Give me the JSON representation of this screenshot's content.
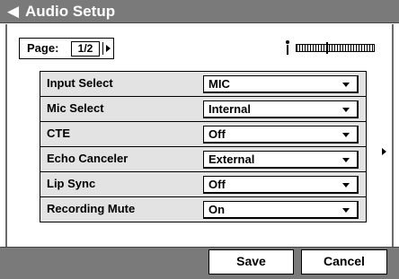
{
  "title_bar": {
    "icon": "speaker-icon",
    "title": "Audio Setup"
  },
  "pagination": {
    "label": "Page:",
    "value": "1/2",
    "next_icon": "right-arrow-icon"
  },
  "input_level": {
    "icon": "microphone-icon",
    "level_fraction": 0.38
  },
  "settings": [
    {
      "label": "Input Select",
      "value": "MIC"
    },
    {
      "label": "Mic Select",
      "value": "Internal"
    },
    {
      "label": "CTE",
      "value": "Off"
    },
    {
      "label": "Echo Canceler",
      "value": "External"
    },
    {
      "label": "Lip Sync",
      "value": "Off"
    },
    {
      "label": "Recording Mute",
      "value": "On"
    }
  ],
  "footer": {
    "save_label": "Save",
    "cancel_label": "Cancel"
  },
  "colors": {
    "bar": "#7a7a7a",
    "panel": "#e3e3e3"
  }
}
